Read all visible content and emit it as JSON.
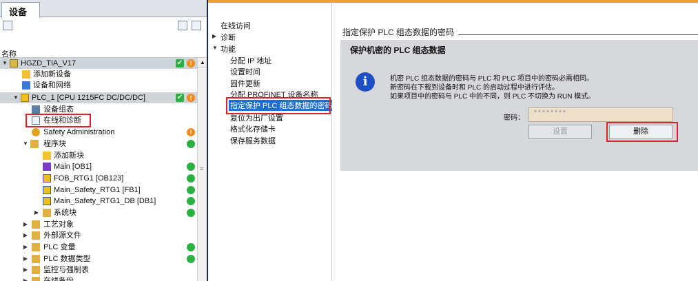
{
  "left_pane": {
    "tab_label": "设备",
    "column_header": "名称",
    "tree": [
      {
        "label": "HGZD_TIA_V17",
        "status": [
          "check",
          "warn"
        ]
      },
      {
        "label": "添加新设备",
        "status": []
      },
      {
        "label": "设备和网络",
        "status": []
      },
      {
        "label": "PLC_1 [CPU 1215FC DC/DC/DC]",
        "status": [
          "check",
          "warn"
        ]
      },
      {
        "label": "设备组态",
        "status": []
      },
      {
        "label": "在线和诊断",
        "status": []
      },
      {
        "label": "Safety Administration",
        "status": [
          "warn"
        ]
      },
      {
        "label": "程序块",
        "status": [
          "ok"
        ]
      },
      {
        "label": "添加新块",
        "status": []
      },
      {
        "label": "Main [OB1]",
        "status": [
          "ok"
        ]
      },
      {
        "label": "FOB_RTG1 [OB123]",
        "status": [
          "ok"
        ]
      },
      {
        "label": "Main_Safety_RTG1 [FB1]",
        "status": [
          "ok"
        ]
      },
      {
        "label": "Main_Safety_RTG1_DB [DB1]",
        "status": [
          "ok"
        ]
      },
      {
        "label": "系统块",
        "status": [
          "ok"
        ]
      },
      {
        "label": "工艺对象",
        "status": []
      },
      {
        "label": "外部源文件",
        "status": []
      },
      {
        "label": "PLC 变量",
        "status": [
          "ok"
        ]
      },
      {
        "label": "PLC 数据类型",
        "status": [
          "ok"
        ]
      },
      {
        "label": "监控与强制表",
        "status": []
      },
      {
        "label": "在线备份",
        "status": []
      }
    ],
    "status_glyphs": {
      "check": "✔",
      "warn": "!"
    }
  },
  "nav": {
    "items": [
      {
        "label": "在线访问"
      },
      {
        "label": "诊断"
      },
      {
        "label": "功能"
      },
      {
        "label": "分配 IP 地址"
      },
      {
        "label": "设置时间"
      },
      {
        "label": "固件更新"
      },
      {
        "label": "分配 PROFINET 设备名称"
      },
      {
        "label": "指定保护 PLC 组态数据的密码"
      },
      {
        "label": "复位为出厂设置"
      },
      {
        "label": "格式化存储卡"
      },
      {
        "label": "保存服务数据"
      }
    ]
  },
  "content": {
    "section_title": "指定保护 PLC 组态数据的密码",
    "panel_title": "保护机密的 PLC 组态数据",
    "info_lines": [
      "机密 PLC 组态数据的密码与 PLC 和 PLC 项目中的密码必需相同。",
      "新密码在下载到设备时和 PLC 的启动过程中进行评估。",
      "如果项目中的密码与 PLC 中的不同，则 PLC 不切换为 RUN 模式。"
    ],
    "password_label": "密码：",
    "password_value": "********",
    "set_button": "设置",
    "delete_button": "删除"
  },
  "colors": {
    "accent_orange": "#f0a030",
    "nav_selected": "#1e6fd1",
    "highlight_red": "#e0202a",
    "status_green": "#2bb043",
    "status_orange": "#f08a1c"
  }
}
